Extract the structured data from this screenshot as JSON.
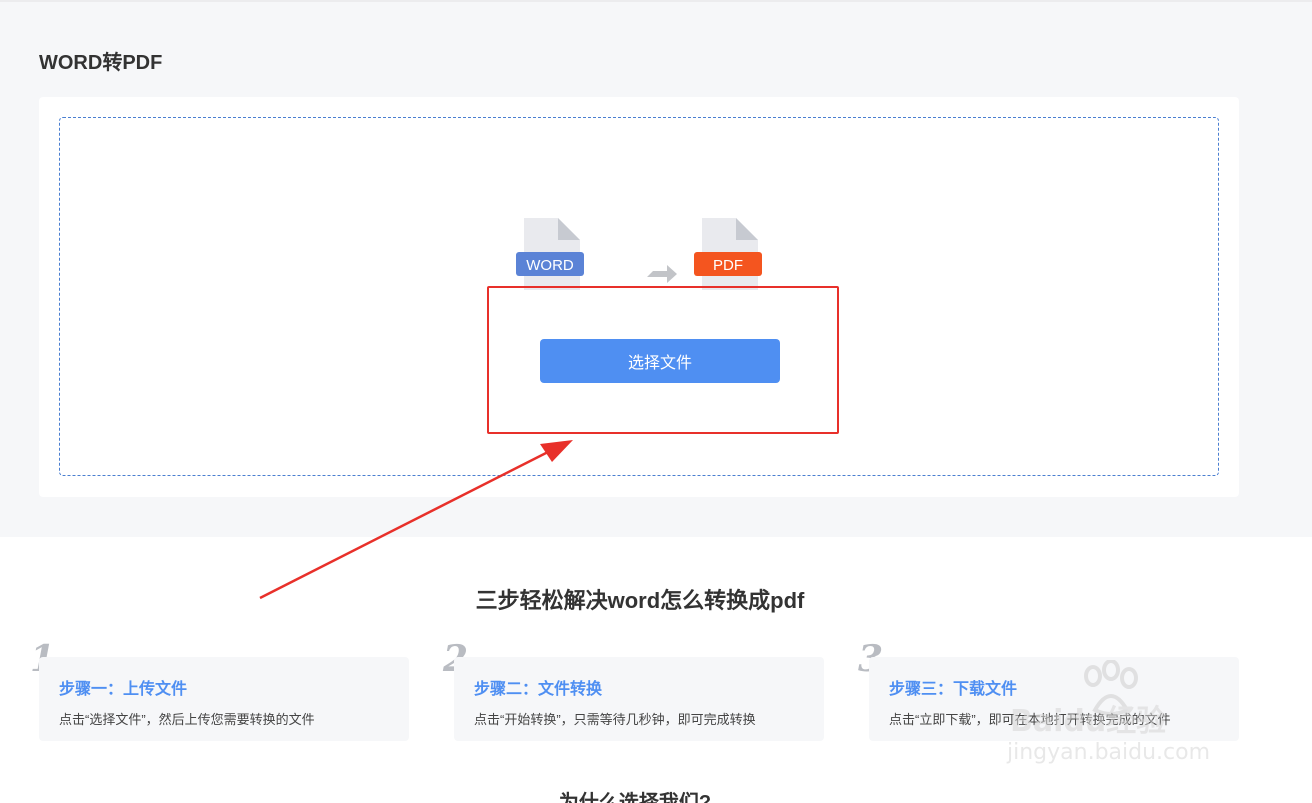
{
  "page": {
    "title": "WORD转PDF"
  },
  "converter": {
    "source_label": "WORD",
    "target_label": "PDF",
    "select_button": "选择文件",
    "colors": {
      "source": "#5b83d6",
      "target": "#f4551f",
      "button": "#4f8ff2",
      "highlight": "#e8302a"
    }
  },
  "steps_section": {
    "title": "三步轻松解决word怎么转换成pdf",
    "steps": [
      {
        "number": "1",
        "heading": "步骤一：上传文件",
        "desc": "点击“选择文件”，然后上传您需要转换的文件"
      },
      {
        "number": "2",
        "heading": "步骤二：文件转换",
        "desc": "点击“开始转换”，只需等待几秒钟，即可完成转换"
      },
      {
        "number": "3",
        "heading": "步骤三：下载文件",
        "desc": "点击“立即下载”，即可在本地打开转换完成的文件"
      }
    ]
  },
  "why_section": {
    "title": "为什么选择我们?"
  },
  "watermark": {
    "brand": "Baidu经验",
    "url": "jingyan.baidu.com"
  }
}
